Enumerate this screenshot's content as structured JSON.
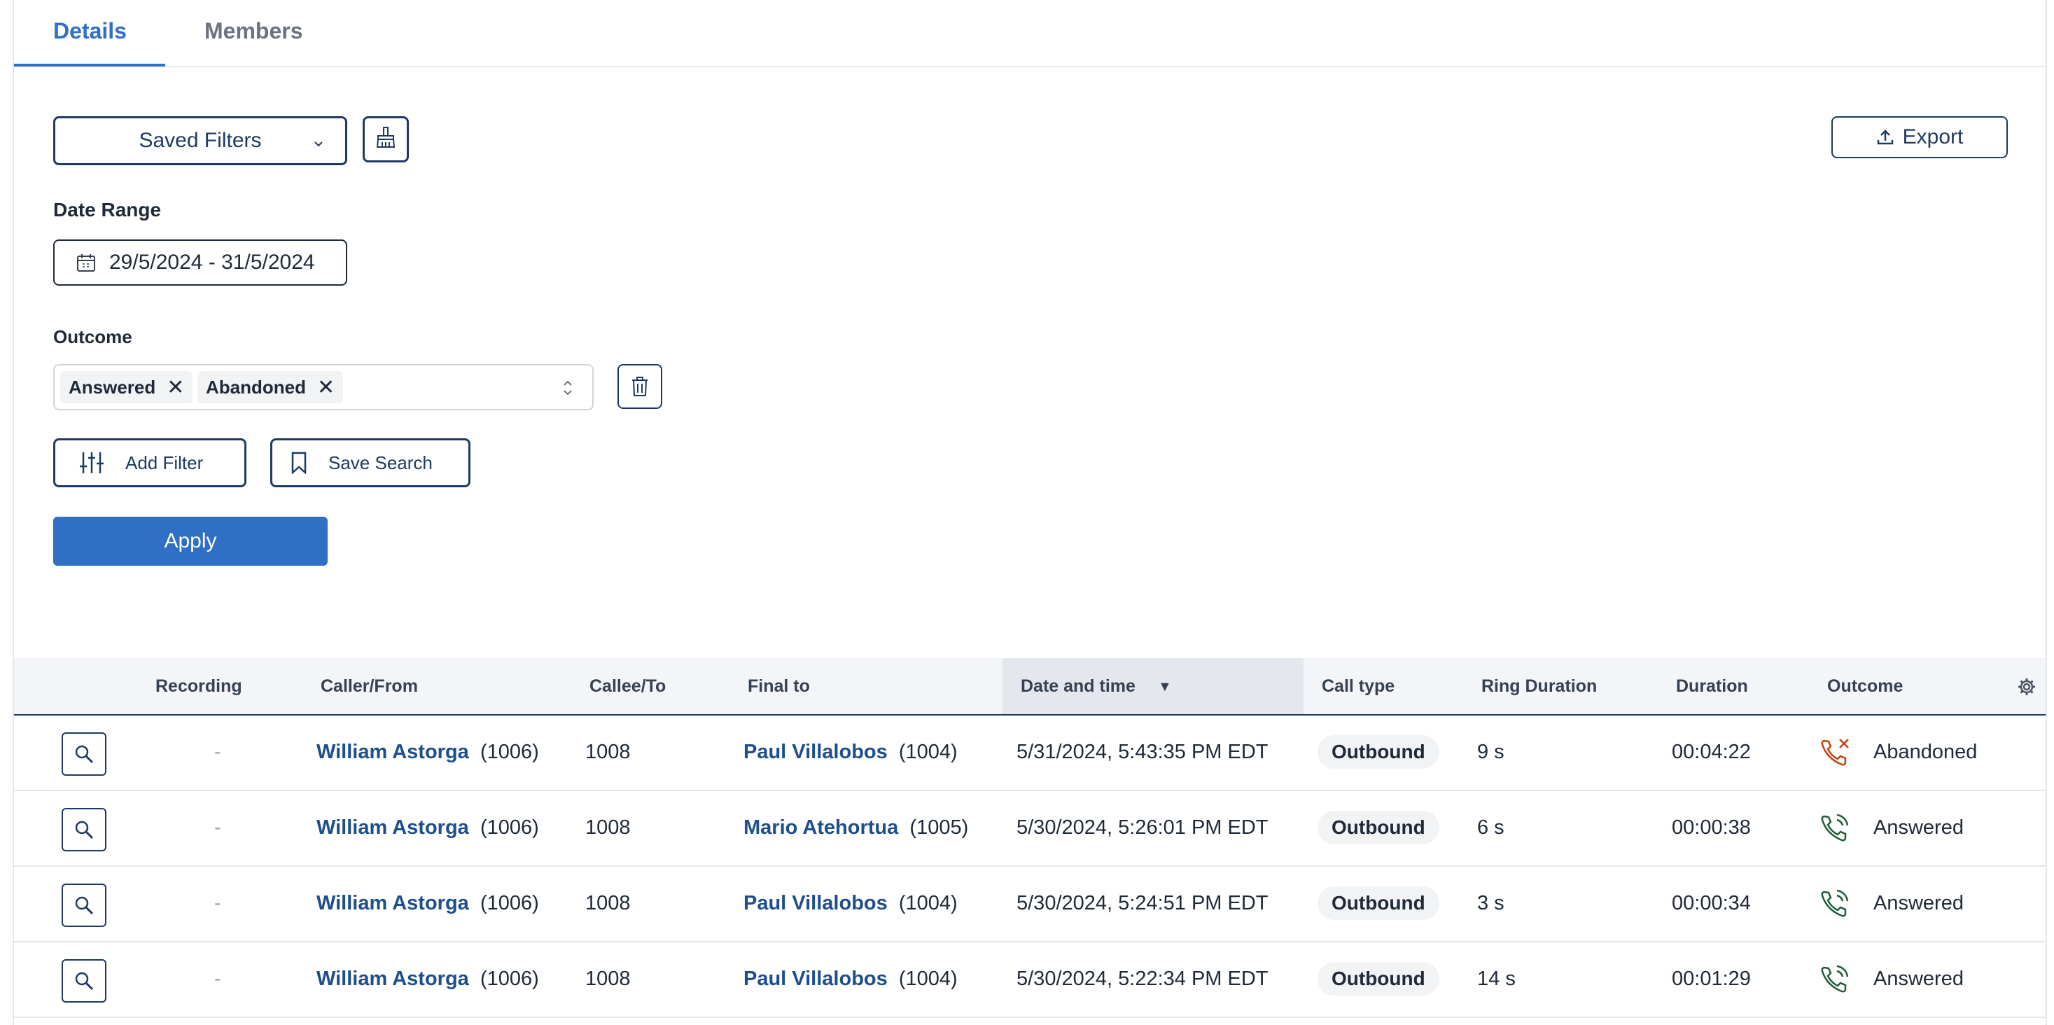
{
  "tabs": [
    {
      "label": "Details",
      "active": true
    },
    {
      "label": "Members",
      "active": false
    }
  ],
  "filters": {
    "saved_filters_label": "Saved Filters",
    "export_label": "Export",
    "date_range_label": "Date Range",
    "date_range_value": "29/5/2024 - 31/5/2024",
    "outcome_label": "Outcome",
    "outcome_chips": [
      "Answered",
      "Abandoned"
    ],
    "add_filter_label": "Add Filter",
    "save_search_label": "Save Search",
    "apply_label": "Apply"
  },
  "table": {
    "columns": [
      "Recording",
      "Caller/From",
      "Callee/To",
      "Final to",
      "Date and time",
      "Call type",
      "Ring Duration",
      "Duration",
      "Outcome"
    ],
    "sort_indicator": "▼",
    "rows": [
      {
        "recording": "-",
        "caller_name": "William Astorga",
        "caller_ext": "(1006)",
        "callee": "1008",
        "final_name": "Paul Villalobos",
        "final_ext": "(1004)",
        "datetime": "5/31/2024, 5:43:35 PM EDT",
        "call_type": "Outbound",
        "ring": "9 s",
        "duration": "00:04:22",
        "outcome": "Abandoned",
        "outcome_status": "abandoned"
      },
      {
        "recording": "-",
        "caller_name": "William Astorga",
        "caller_ext": "(1006)",
        "callee": "1008",
        "final_name": "Mario Atehortua",
        "final_ext": "(1005)",
        "datetime": "5/30/2024, 5:26:01 PM EDT",
        "call_type": "Outbound",
        "ring": "6 s",
        "duration": "00:00:38",
        "outcome": "Answered",
        "outcome_status": "answered"
      },
      {
        "recording": "-",
        "caller_name": "William Astorga",
        "caller_ext": "(1006)",
        "callee": "1008",
        "final_name": "Paul Villalobos",
        "final_ext": "(1004)",
        "datetime": "5/30/2024, 5:24:51 PM EDT",
        "call_type": "Outbound",
        "ring": "3 s",
        "duration": "00:00:34",
        "outcome": "Answered",
        "outcome_status": "answered"
      },
      {
        "recording": "-",
        "caller_name": "William Astorga",
        "caller_ext": "(1006)",
        "callee": "1008",
        "final_name": "Paul Villalobos",
        "final_ext": "(1004)",
        "datetime": "5/30/2024, 5:22:34 PM EDT",
        "call_type": "Outbound",
        "ring": "14 s",
        "duration": "00:01:29",
        "outcome": "Answered",
        "outcome_status": "answered"
      }
    ]
  },
  "colors": {
    "accent": "#2f6fc4",
    "navy": "#1e3a64",
    "link": "#1e4f8c",
    "answered": "#1f5c3a",
    "abandoned": "#c2410c"
  },
  "icons": {
    "dropdown": "chevron-down-icon",
    "clear_filters": "broom-icon",
    "export": "upload-icon",
    "date": "calendar-icon",
    "chip_remove": "close-icon",
    "select_arrows": "chevron-up-down-icon",
    "delete": "trash-icon",
    "add_filter": "sliders-icon",
    "save_search": "bookmark-icon",
    "row_action": "search-icon",
    "settings": "gear-icon",
    "answered": "phone-incoming-icon",
    "abandoned": "phone-missed-icon"
  }
}
